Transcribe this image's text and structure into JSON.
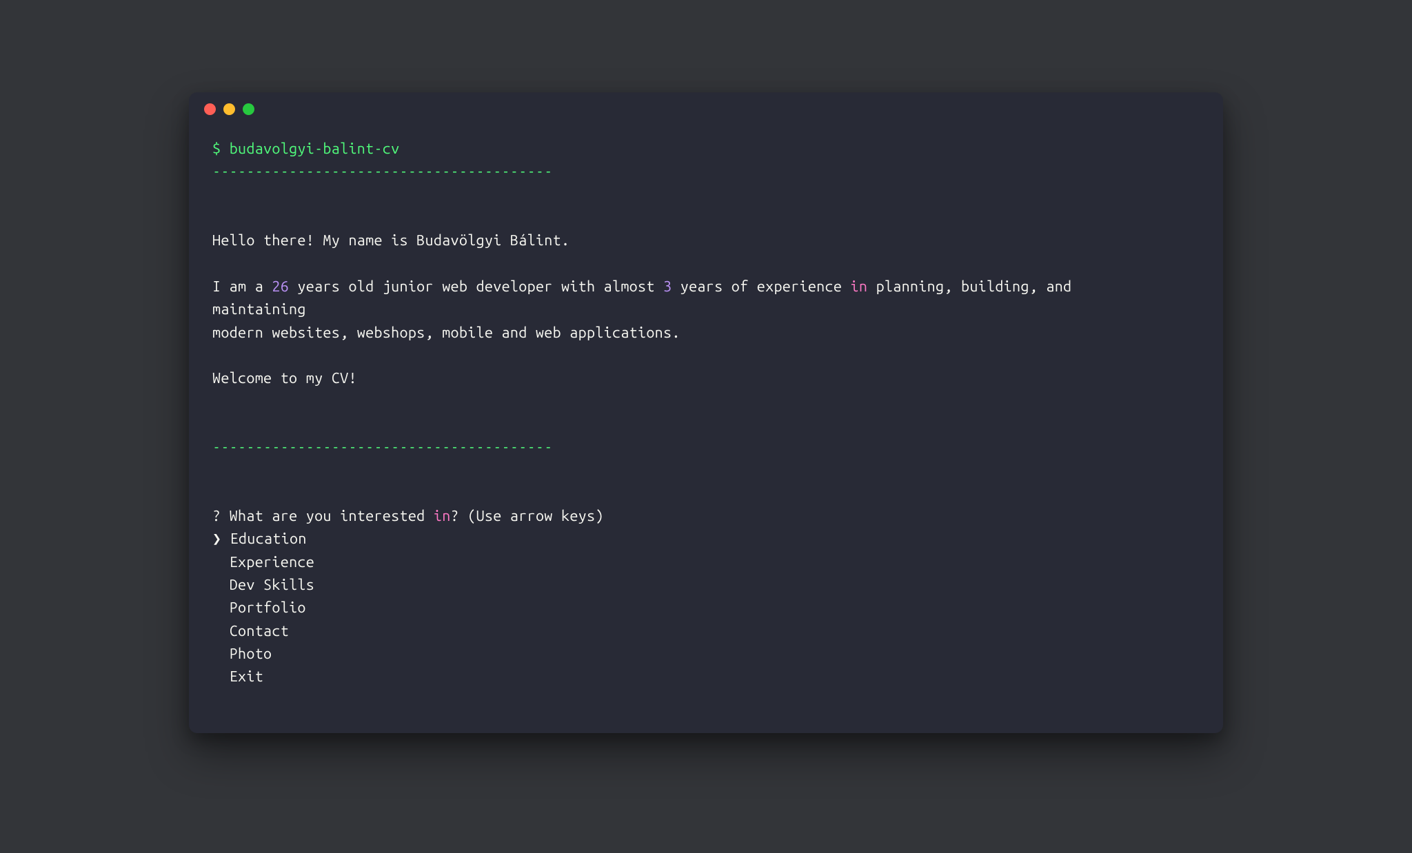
{
  "command": {
    "prompt_symbol": "$ ",
    "cmd": "budavolgyi-balint-cv"
  },
  "separator": "----------------------------------------",
  "intro": {
    "line1": "Hello there! My name is Budavölgyi Bálint.",
    "line2a": "I am a ",
    "age": "26",
    "line2b": " years old junior web developer with almost ",
    "years_exp": "3",
    "line2c": " years of experience ",
    "keyword_in": "in",
    "line2d": " planning, building, and",
    "line3": "maintaining",
    "line4": "modern websites, webshops, mobile and web applications.",
    "welcome": "Welcome to my CV!"
  },
  "menu": {
    "question_mark": "?",
    "question_a": " What are you interested ",
    "question_kw": "in",
    "question_b": "? ",
    "hint": "(Use arrow keys)",
    "pointer": "❯ ",
    "indent": "  ",
    "options": [
      "Education",
      "Experience",
      "Dev Skills",
      "Portfolio",
      "Contact",
      "Photo",
      "Exit"
    ]
  }
}
